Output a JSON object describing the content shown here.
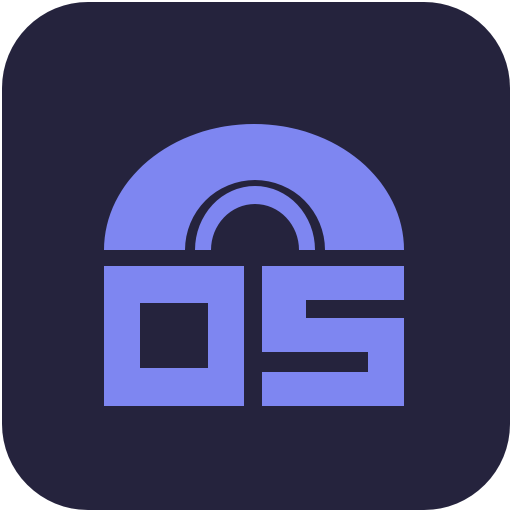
{
  "icon": {
    "name": "os-lock-app-icon",
    "text": "OS",
    "colors": {
      "background": "#25233d",
      "glyph": "#7e86f1"
    }
  }
}
